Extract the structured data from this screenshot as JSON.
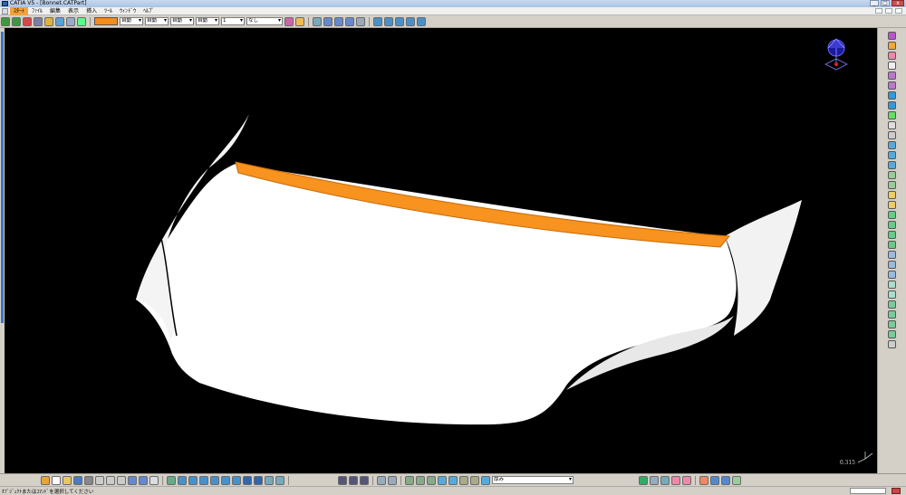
{
  "window": {
    "title": "CATIA V5 - [Bonnet.CATPart]",
    "controls": [
      "_",
      "□",
      "x"
    ]
  },
  "menu": {
    "items": [
      "ｽﾀｰﾄ",
      "ﾌｧｲﾙ",
      "編集",
      "表示",
      "挿入",
      "ﾂｰﾙ",
      "ｳｨﾝﾄﾞｳ",
      "ﾍﾙﾌﾟ"
    ],
    "active_index": 0
  },
  "graphic_properties": {
    "fill_color": "#f28c1e",
    "transparency": "自動",
    "line_thickness": "自動",
    "line_type": "自動",
    "point_type": "自動",
    "layer_label": "1",
    "rendering_style": "なし"
  },
  "viewport": {
    "background": "#000000",
    "scale_readout": "0.315",
    "highlight_color": "#f7931e"
  },
  "bottom_toolbar": {
    "view_mode": "厚み"
  },
  "status": {
    "message": "ｵﾌﾞｼﾞｪｸﾄまたはｺﾏﾝﾄﾞを選択してください"
  }
}
